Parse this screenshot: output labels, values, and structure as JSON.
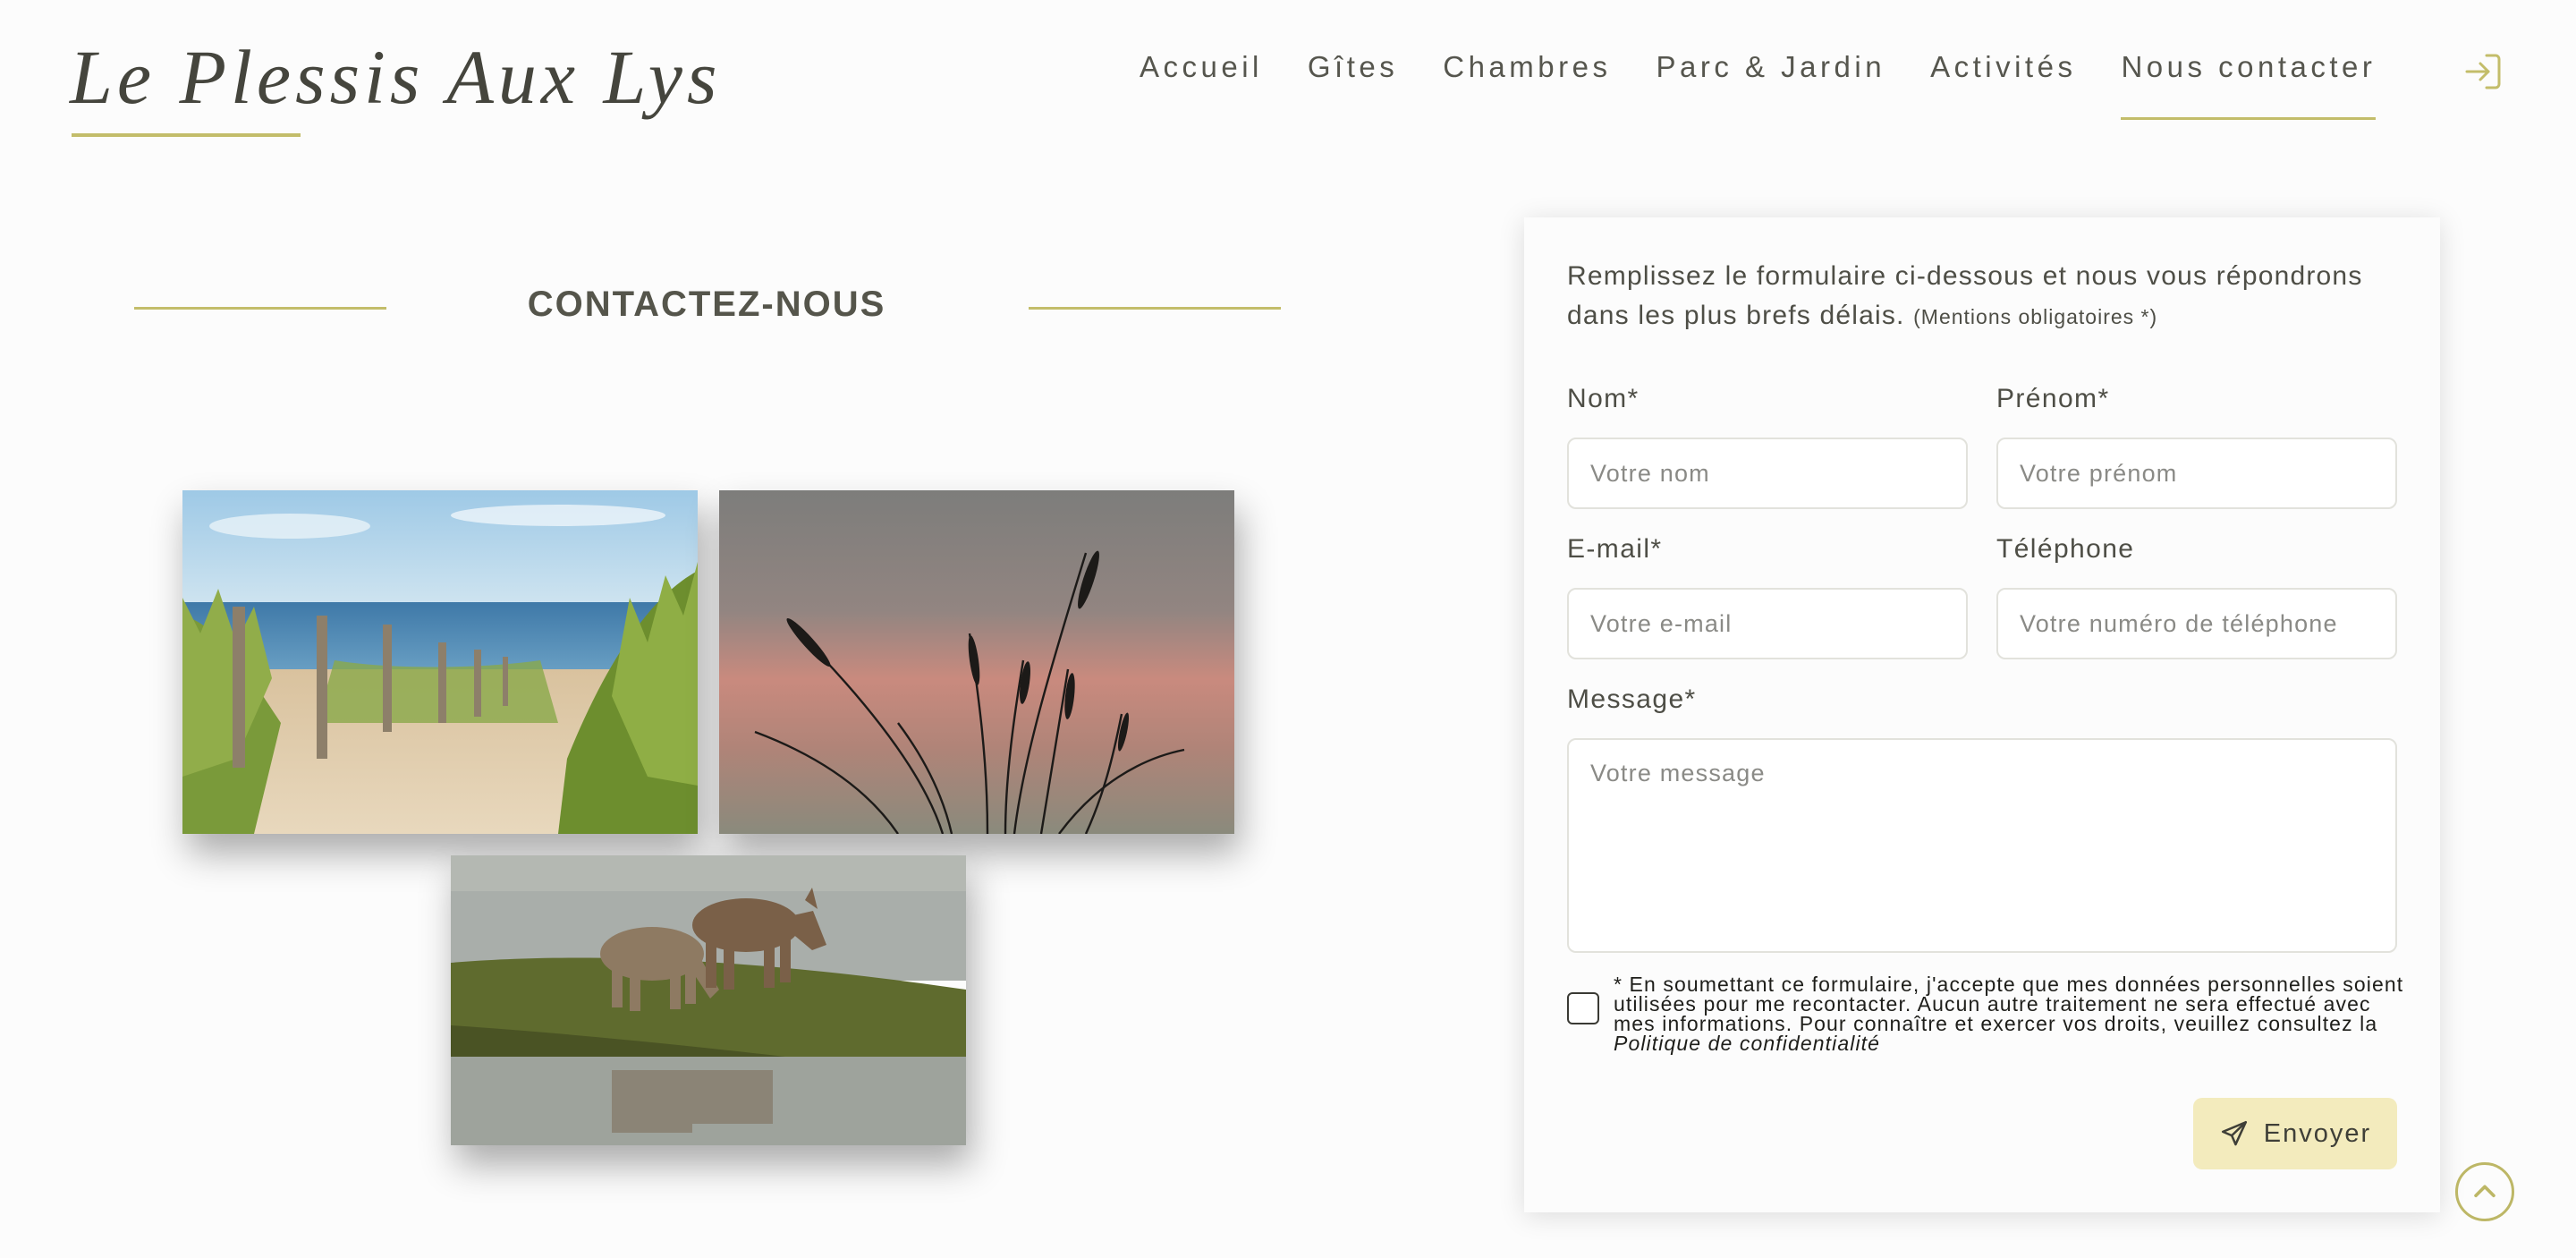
{
  "header": {
    "logo": "Le Plessis Aux Lys",
    "nav": [
      "Accueil",
      "Gîtes",
      "Chambres",
      "Parc & Jardin",
      "Activités",
      "Nous contacter"
    ],
    "active_nav": "Nous contacter",
    "login_icon": "login-icon"
  },
  "contact": {
    "heading": "CONTACTEZ-NOUS"
  },
  "photos": [
    {
      "icon": "beach-dune-path-photo"
    },
    {
      "icon": "grass-sunset-silhouette-photo"
    },
    {
      "icon": "donkeys-grazing-photo"
    }
  ],
  "form": {
    "intro": "Remplissez le formulaire ci-dessous et nous vous répondrons dans les plus brefs délais.",
    "intro_note": "(Mentions obligatoires *)",
    "nom": {
      "label": "Nom*",
      "placeholder": "Votre nom"
    },
    "prenom": {
      "label": "Prénom*",
      "placeholder": "Votre prénom"
    },
    "email": {
      "label": "E-mail*",
      "placeholder": "Votre e-mail"
    },
    "telephone": {
      "label": "Téléphone",
      "placeholder": "Votre numéro de téléphone"
    },
    "message": {
      "label": "Message*",
      "placeholder": "Votre message"
    },
    "consent_text": "* En soumettant ce formulaire, j'accepte que mes données personnelles soient utilisées pour me recontacter. Aucun autre traitement ne sera effectué avec mes informations. Pour connaître et exercer vos droits, veuillez consultez la",
    "consent_link": "Politique de confidentialité",
    "submit_label": "Envoyer",
    "submit_icon": "send-icon"
  },
  "scroll_top_icon": "chevron-up-icon",
  "colors": {
    "accent": "#c3bd6a",
    "button_bg": "#f3ebbd",
    "text": "#4a4a42"
  }
}
